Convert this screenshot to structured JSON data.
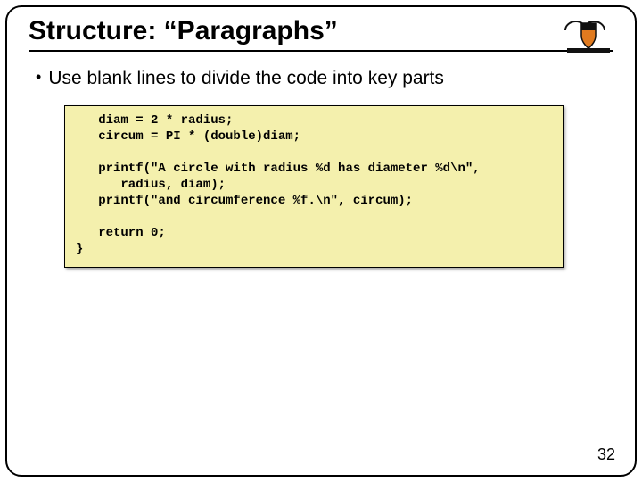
{
  "title": "Structure: “Paragraphs”",
  "bullet": "Use blank lines to divide the code into key parts",
  "code": "   diam = 2 * radius;\n   circum = PI * (double)diam;\n\n   printf(\"A circle with radius %d has diameter %d\\n\",\n      radius, diam);\n   printf(\"and circumference %f.\\n\", circum);\n\n   return 0;\n}",
  "page_number": "32",
  "logo_name": "princeton-shield"
}
